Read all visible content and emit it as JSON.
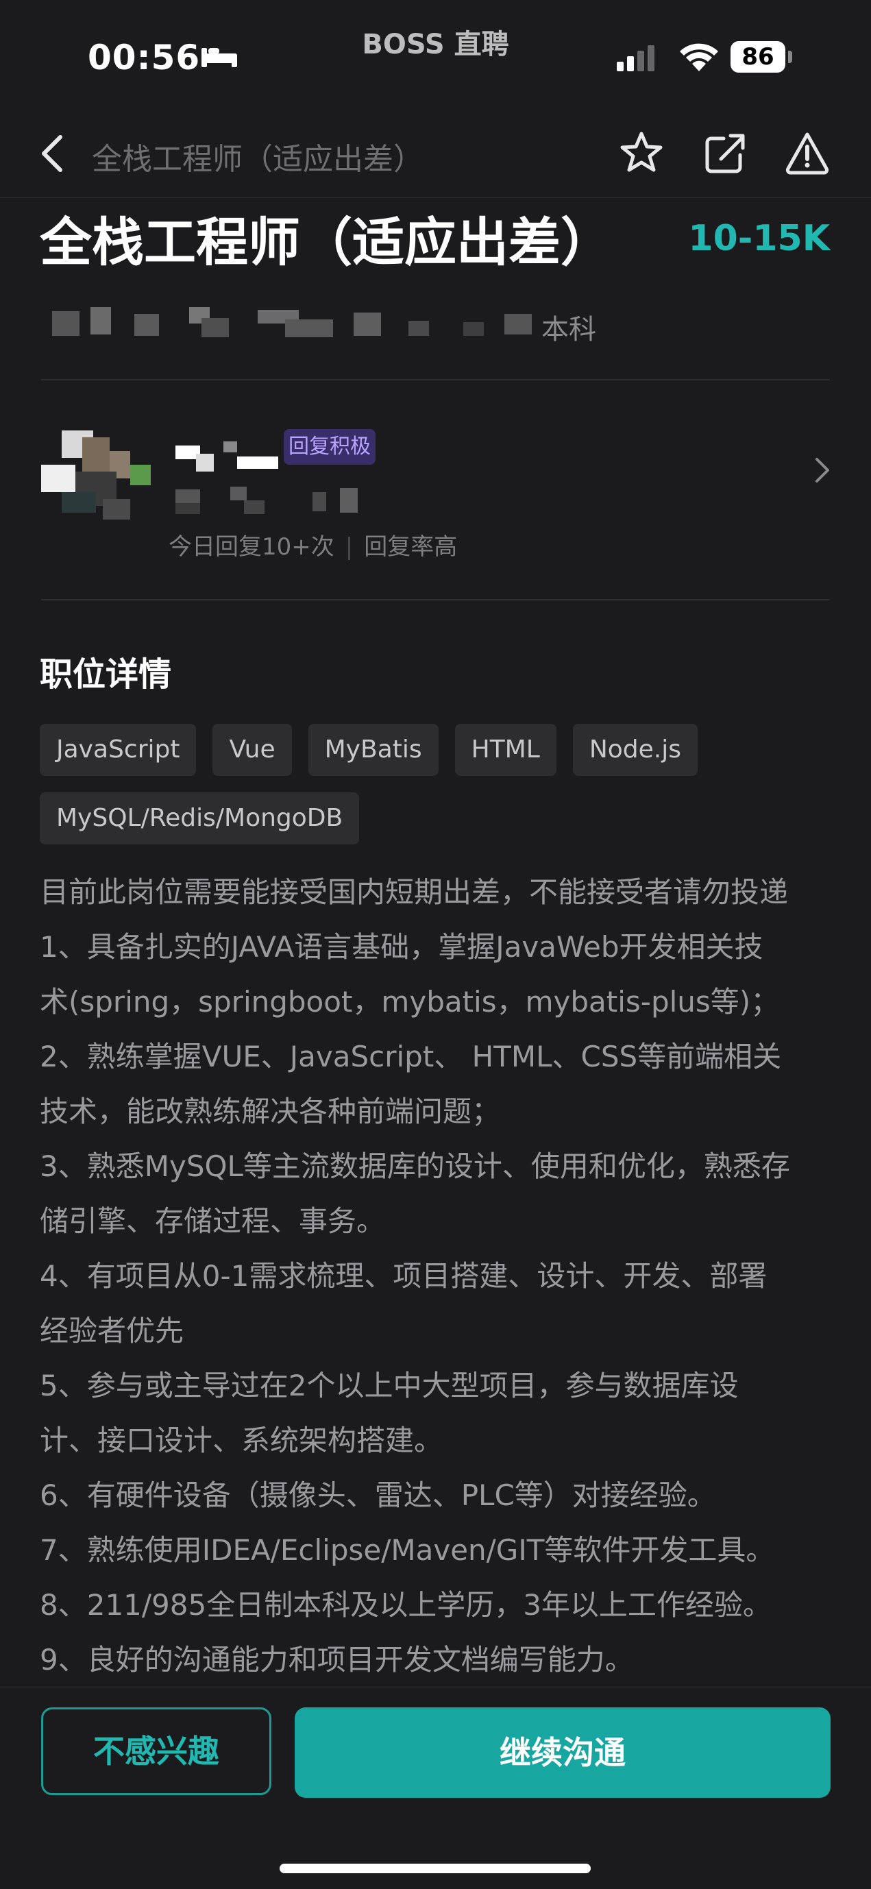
{
  "status_bar": {
    "time": "00:56",
    "app_name": "BOSS 直聘",
    "battery": "86",
    "icons": [
      "bed-icon",
      "signal-icon",
      "wifi-icon",
      "battery-icon"
    ]
  },
  "navbar": {
    "title": "全栈工程师（适应出差）",
    "icons": [
      "back-icon",
      "star-icon",
      "share-icon",
      "warning-icon"
    ]
  },
  "job": {
    "title": "全栈工程师（适应出差）",
    "salary": "10-15K",
    "meta_visible": "本科"
  },
  "recruiter": {
    "badge": "回复积极",
    "reply_count": "今日回复10+次",
    "reply_rate": "回复率高"
  },
  "details": {
    "section_title": "职位详情",
    "tags": [
      "JavaScript",
      "Vue",
      "MyBatis",
      "HTML",
      "Node.js",
      "MySQL/Redis/MongoDB"
    ],
    "description_lines": [
      "目前此岗位需要能接受国内短期出差，不能接受者请勿投递",
      "1、具备扎实的JAVA语言基础，掌握JavaWeb开发相关技",
      "术(spring，springboot，mybatis，mybatis-plus等)；",
      "2、熟练掌握VUE、JavaScript、 HTML、CSS等前端相关",
      "技术，能改熟练解决各种前端问题；",
      "3、熟悉MySQL等主流数据库的设计、使用和优化，熟悉存",
      "储引擎、存储过程、事务。",
      "4、有项目从0-1需求梳理、项目搭建、设计、开发、部署",
      "经验者优先",
      "5、参与或主导过在2个以上中大型项目，参与数据库设",
      "计、接口设计、系统架构搭建。",
      "6、有硬件设备（摄像头、雷达、PLC等）对接经验。",
      "7、熟练使用IDEA/Eclipse/Maven/GIT等软件开发工具。",
      "8、211/985全日制本科及以上学历，3年以上工作经验。",
      "9、良好的沟通能力和项目开发文档编写能力。"
    ]
  },
  "actions": {
    "not_interested": "不感兴趣",
    "continue_chat": "继续沟通"
  },
  "colors": {
    "background": "#1b1b1d",
    "accent": "#17a7a0",
    "salary": "#20b8b0"
  }
}
